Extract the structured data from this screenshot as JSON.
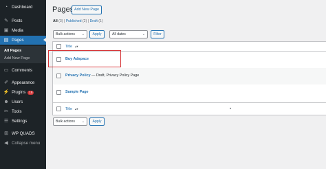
{
  "sidebar": {
    "items": [
      {
        "label": "Dashboard",
        "icon": "gauge-icon"
      },
      {
        "label": "Posts",
        "icon": "pin-icon"
      },
      {
        "label": "Media",
        "icon": "media-icon"
      },
      {
        "label": "Pages",
        "icon": "page-icon"
      },
      {
        "label": "Comments",
        "icon": "comment-icon"
      },
      {
        "label": "Appearance",
        "icon": "brush-icon"
      },
      {
        "label": "Plugins",
        "icon": "plugin-icon",
        "badge": "15"
      },
      {
        "label": "Users",
        "icon": "users-icon"
      },
      {
        "label": "Tools",
        "icon": "wrench-icon"
      },
      {
        "label": "Settings",
        "icon": "sliders-icon"
      },
      {
        "label": "WP QUADS",
        "icon": "quads-icon"
      },
      {
        "label": "Collapse menu",
        "icon": "collapse-icon"
      }
    ],
    "submenu": {
      "all_pages": "All Pages",
      "add_new_page": "Add New Page"
    }
  },
  "header": {
    "title": "Pages",
    "add_new_label": "Add New Page"
  },
  "filters": {
    "all": "All",
    "all_count": "(3)",
    "sep1": "|",
    "published": "Published",
    "published_count": "(2)",
    "sep2": "|",
    "draft": "Draft",
    "draft_count": "(1)"
  },
  "controls": {
    "bulk_actions": "Bulk actions",
    "apply": "Apply",
    "all_dates": "All dates",
    "filter": "Filter"
  },
  "table": {
    "column_title": "Title",
    "rows": [
      {
        "title": "Buy Adspace",
        "state": ""
      },
      {
        "title": "Privacy Policy",
        "state": " — Draft, Privacy Policy Page"
      },
      {
        "title": "Sample Page",
        "state": ""
      }
    ]
  },
  "colors": {
    "sidebar_bg": "#1d2327",
    "accent": "#2271b1",
    "highlight": "#d63638"
  }
}
